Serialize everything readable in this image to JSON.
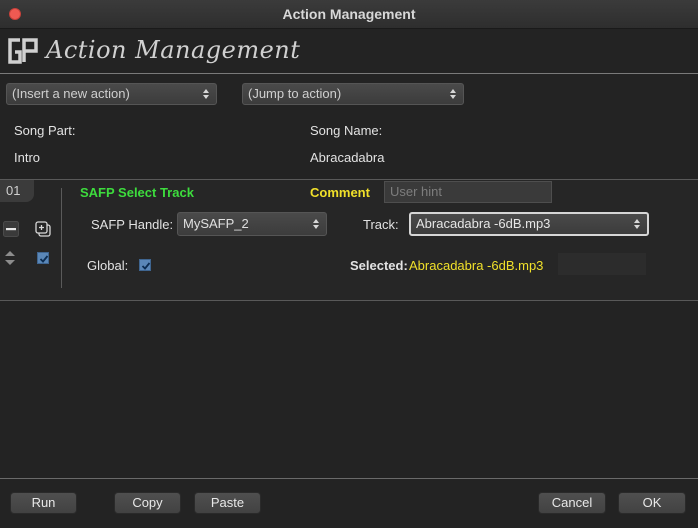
{
  "window": {
    "title": "Action Management"
  },
  "header": {
    "logo_text": "Action Management"
  },
  "toolbar": {
    "insert_action": {
      "value": "(Insert a new action)"
    },
    "jump_to_action": {
      "value": "(Jump to action)"
    }
  },
  "song": {
    "part_label": "Song Part:",
    "part_value": "Intro",
    "name_label": "Song Name:",
    "name_value": "Abracadabra"
  },
  "action": {
    "number": "01",
    "type": "SAFP Select Track",
    "comment_label": "Comment",
    "comment_placeholder": "User hint",
    "handle_label": "SAFP Handle:",
    "handle_value": "MySAFP_2",
    "track_label": "Track:",
    "track_value": "Abracadabra -6dB.mp3",
    "global_label": "Global:",
    "global_checked": true,
    "enabled_checked": true,
    "selected_label": "Selected:",
    "selected_value": "Abracadabra -6dB.mp3"
  },
  "buttons": {
    "run": "Run",
    "copy": "Copy",
    "paste": "Paste",
    "cancel": "Cancel",
    "ok": "OK"
  },
  "colors": {
    "action_type": "#3ddc3d",
    "highlight": "#f0e02a",
    "checkbox": "#5a87b8"
  }
}
